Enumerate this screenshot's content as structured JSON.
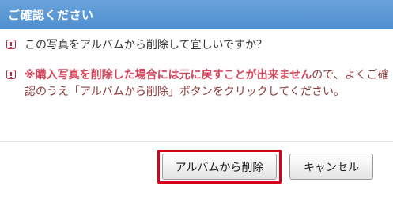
{
  "dialog": {
    "title": "ご確認ください",
    "messages": [
      {
        "text": "この写真をアルバムから削除して宜しいですか？"
      },
      {
        "emphasis": "※購入写真を削除した場合には元に戻すことが出来ません",
        "text": "ので、よくご確認のうえ「アルバムから削除」ボタンをクリックしてください。"
      }
    ],
    "buttons": {
      "delete_label": "アルバムから削除",
      "cancel_label": "キャンセル"
    },
    "colors": {
      "titlebar": "#5a98d6",
      "warning_icon": "#c0203f",
      "emphasis_text": "#d4475d",
      "highlight_frame": "#d8001b"
    }
  }
}
